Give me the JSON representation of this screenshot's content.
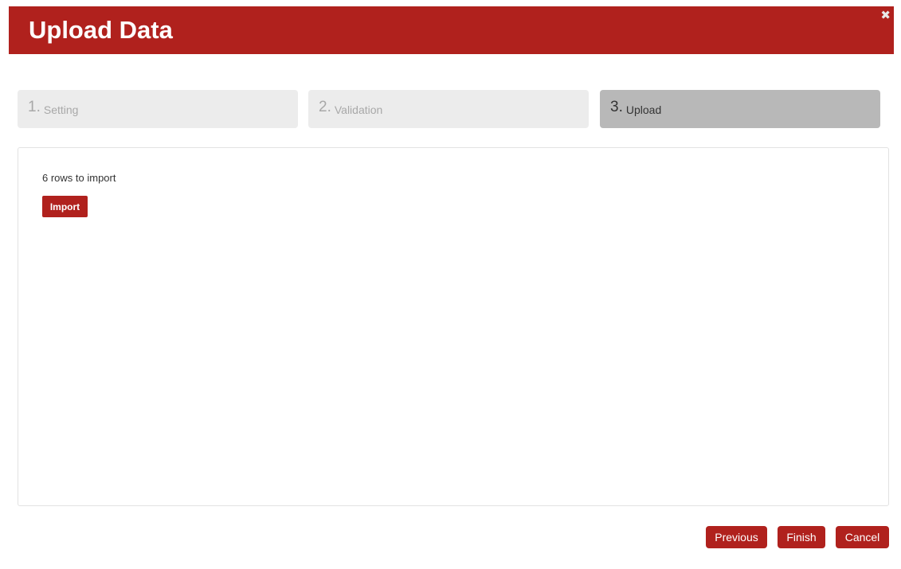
{
  "header": {
    "title": "Upload Data",
    "close_icon": "close-icon",
    "close_glyph": "✖"
  },
  "steps": [
    {
      "number": "1.",
      "label": "Setting",
      "active": false
    },
    {
      "number": "2.",
      "label": "Validation",
      "active": false
    },
    {
      "number": "3.",
      "label": "Upload",
      "active": true
    }
  ],
  "content": {
    "rows_text": "6 rows to import",
    "import_label": "Import"
  },
  "footer": {
    "previous_label": "Previous",
    "finish_label": "Finish",
    "cancel_label": "Cancel"
  },
  "colors": {
    "accent": "#b0211d",
    "step_inactive_bg": "#ececec",
    "step_active_bg": "#b8b8b8"
  }
}
